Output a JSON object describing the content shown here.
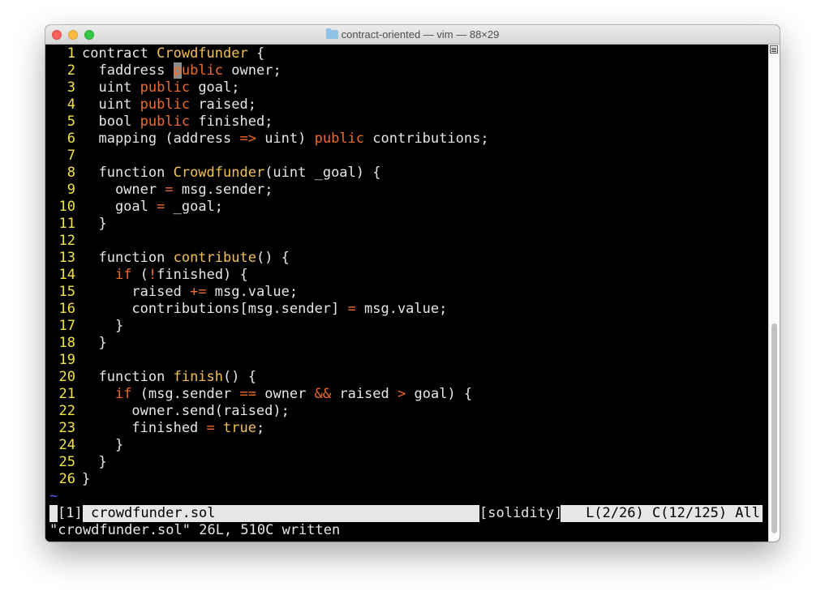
{
  "window": {
    "title": "contract-oriented — vim — 88×29"
  },
  "editor": {
    "lines": [
      {
        "n": "1",
        "segs": [
          {
            "t": "contract "
          },
          {
            "t": "Crowdfunder",
            "c": "fn"
          },
          {
            "t": " {"
          }
        ]
      },
      {
        "n": "2",
        "segs": [
          {
            "t": "  faddress "
          },
          {
            "t": "p",
            "c": "cursor"
          },
          {
            "t": "ublic",
            "c": "kw"
          },
          {
            "t": " owner;"
          }
        ]
      },
      {
        "n": "3",
        "segs": [
          {
            "t": "  uint "
          },
          {
            "t": "public",
            "c": "kw"
          },
          {
            "t": " goal;"
          }
        ]
      },
      {
        "n": "4",
        "segs": [
          {
            "t": "  uint "
          },
          {
            "t": "public",
            "c": "kw"
          },
          {
            "t": " raised;"
          }
        ]
      },
      {
        "n": "5",
        "segs": [
          {
            "t": "  bool "
          },
          {
            "t": "public",
            "c": "kw"
          },
          {
            "t": " finished;"
          }
        ]
      },
      {
        "n": "6",
        "segs": [
          {
            "t": "  mapping (address "
          },
          {
            "t": "=>",
            "c": "op"
          },
          {
            "t": " uint) "
          },
          {
            "t": "public",
            "c": "kw"
          },
          {
            "t": " contributions;"
          }
        ]
      },
      {
        "n": "7",
        "segs": []
      },
      {
        "n": "8",
        "segs": [
          {
            "t": "  function "
          },
          {
            "t": "Crowdfunder",
            "c": "fn"
          },
          {
            "t": "(uint _goal) {"
          }
        ]
      },
      {
        "n": "9",
        "segs": [
          {
            "t": "    owner "
          },
          {
            "t": "=",
            "c": "op"
          },
          {
            "t": " msg.sender;"
          }
        ]
      },
      {
        "n": "10",
        "segs": [
          {
            "t": "    goal "
          },
          {
            "t": "=",
            "c": "op"
          },
          {
            "t": " _goal;"
          }
        ]
      },
      {
        "n": "11",
        "segs": [
          {
            "t": "  }"
          }
        ]
      },
      {
        "n": "12",
        "segs": []
      },
      {
        "n": "13",
        "segs": [
          {
            "t": "  function "
          },
          {
            "t": "contribute",
            "c": "fn"
          },
          {
            "t": "() {"
          }
        ]
      },
      {
        "n": "14",
        "segs": [
          {
            "t": "    "
          },
          {
            "t": "if",
            "c": "kw"
          },
          {
            "t": " ("
          },
          {
            "t": "!",
            "c": "op"
          },
          {
            "t": "finished) {"
          }
        ]
      },
      {
        "n": "15",
        "segs": [
          {
            "t": "      raised "
          },
          {
            "t": "+=",
            "c": "op"
          },
          {
            "t": " msg.value;"
          }
        ]
      },
      {
        "n": "16",
        "segs": [
          {
            "t": "      contributions[msg.sender] "
          },
          {
            "t": "=",
            "c": "op"
          },
          {
            "t": " msg.value;"
          }
        ]
      },
      {
        "n": "17",
        "segs": [
          {
            "t": "    }"
          }
        ]
      },
      {
        "n": "18",
        "segs": [
          {
            "t": "  }"
          }
        ]
      },
      {
        "n": "19",
        "segs": []
      },
      {
        "n": "20",
        "segs": [
          {
            "t": "  function "
          },
          {
            "t": "finish",
            "c": "fn"
          },
          {
            "t": "() {"
          }
        ]
      },
      {
        "n": "21",
        "segs": [
          {
            "t": "    "
          },
          {
            "t": "if",
            "c": "kw"
          },
          {
            "t": " (msg.sender "
          },
          {
            "t": "==",
            "c": "op"
          },
          {
            "t": " owner "
          },
          {
            "t": "&&",
            "c": "op"
          },
          {
            "t": " raised "
          },
          {
            "t": ">",
            "c": "op"
          },
          {
            "t": " goal) {"
          }
        ]
      },
      {
        "n": "22",
        "segs": [
          {
            "t": "      owner.send(raised);"
          }
        ]
      },
      {
        "n": "23",
        "segs": [
          {
            "t": "      finished "
          },
          {
            "t": "=",
            "c": "op"
          },
          {
            "t": " "
          },
          {
            "t": "true",
            "c": "fn"
          },
          {
            "t": ";"
          }
        ]
      },
      {
        "n": "24",
        "segs": [
          {
            "t": "    }"
          }
        ]
      },
      {
        "n": "25",
        "segs": [
          {
            "t": "  }"
          }
        ]
      },
      {
        "n": "26",
        "segs": [
          {
            "t": "}"
          }
        ]
      }
    ],
    "tilde": "~"
  },
  "statusline": {
    "buffer": "[1]",
    "filename": "crowdfunder.sol",
    "filetype": "[solidity]",
    "position": "L(2/26) C(12/125) All"
  },
  "cmdline": "\"crowdfunder.sol\" 26L, 510C written",
  "colors": {
    "keyword": "#ee6b2a",
    "function_name": "#f2c04f",
    "line_number": "#f2e43f",
    "tilde": "#5c5cff"
  }
}
